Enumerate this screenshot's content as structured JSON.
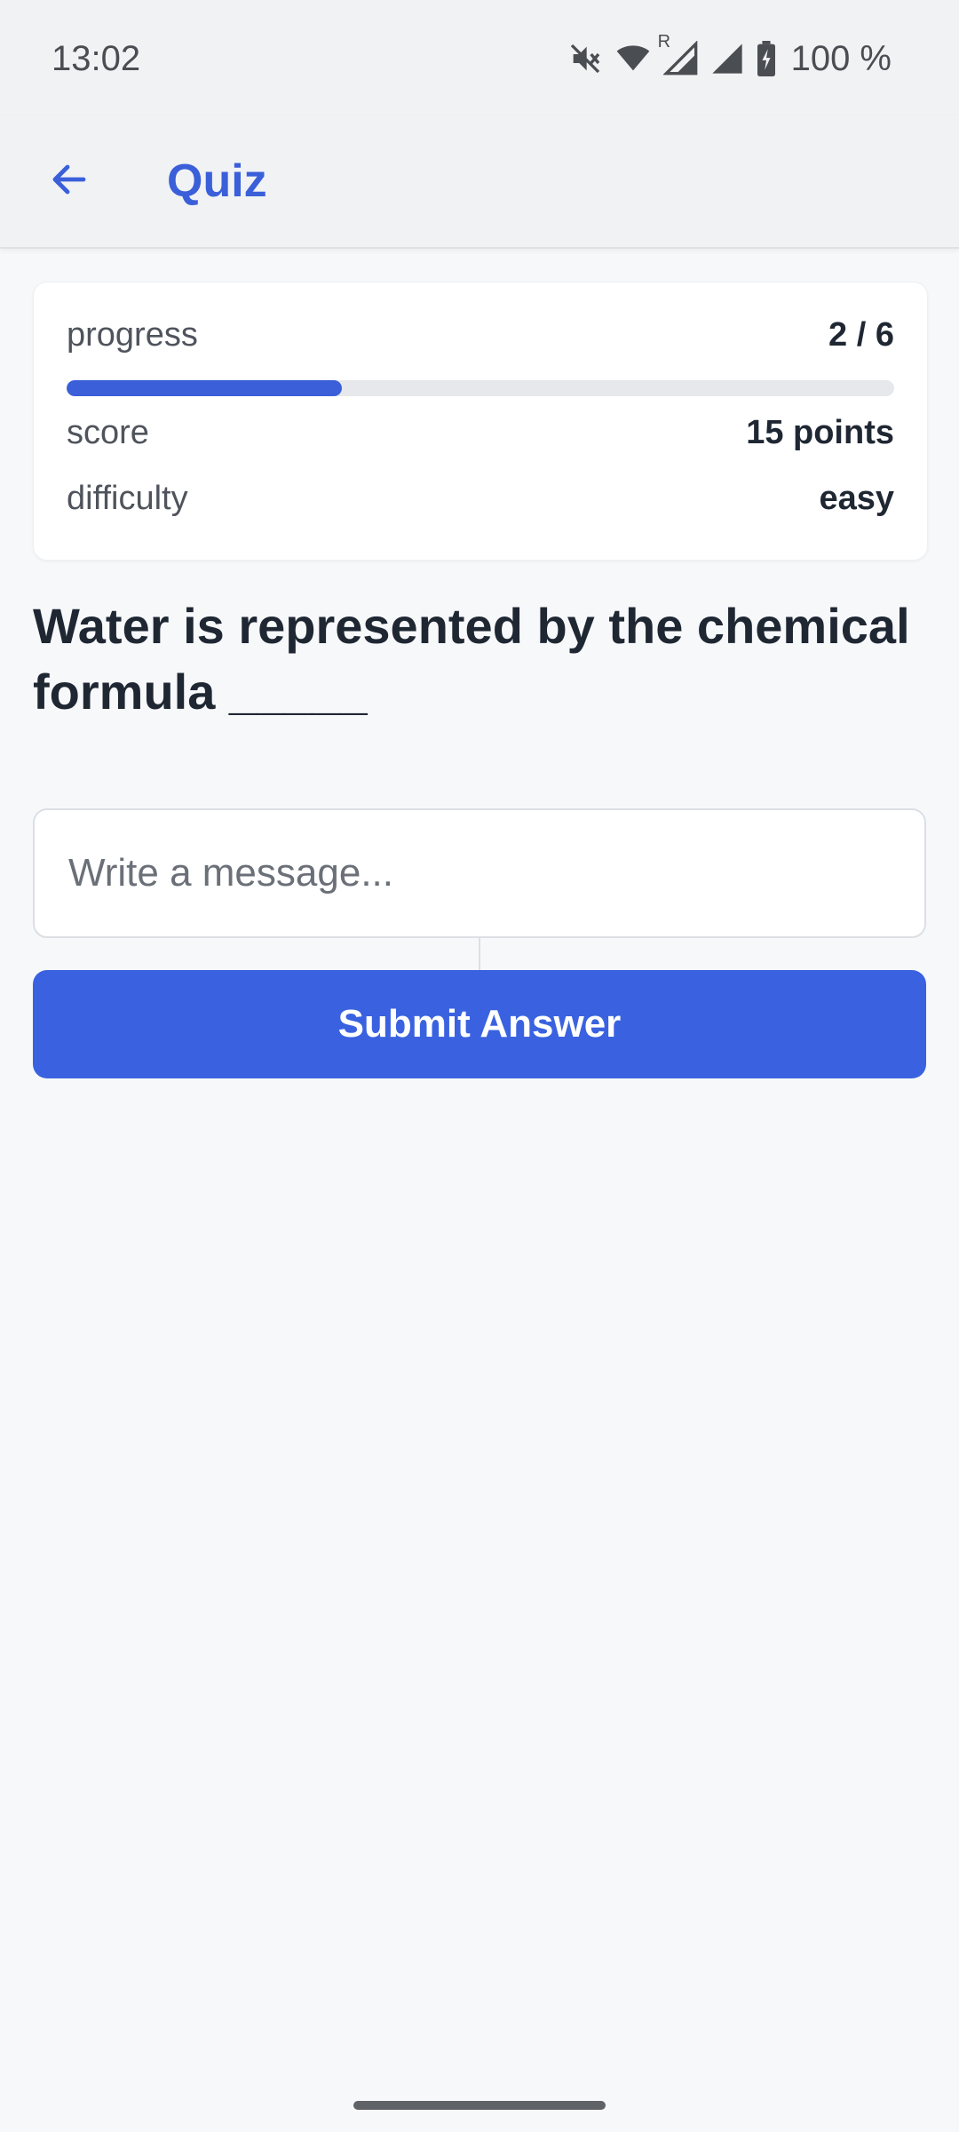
{
  "status_bar": {
    "time": "13:02",
    "battery": "100 %",
    "icons": [
      "mute-icon",
      "wifi-icon",
      "signal-roaming-icon",
      "signal-icon",
      "battery-charging-icon"
    ],
    "roaming_label": "R"
  },
  "app_bar": {
    "back_icon": "arrow-left-icon",
    "title": "Quiz"
  },
  "stats": {
    "progress_label": "progress",
    "progress_value": "2 / 6",
    "progress_fraction": 0.333,
    "score_label": "score",
    "score_value": "15 points",
    "difficulty_label": "difficulty",
    "difficulty_value": "easy"
  },
  "question": {
    "text": "Water is represented by the chemical formula _____"
  },
  "answer": {
    "value": "",
    "placeholder": "Write a message..."
  },
  "submit": {
    "label": "Submit Answer"
  },
  "colors": {
    "accent": "#3a5fd9",
    "button": "#3a62e0",
    "background": "#f7f8fa",
    "text_dark": "#1f2733"
  }
}
